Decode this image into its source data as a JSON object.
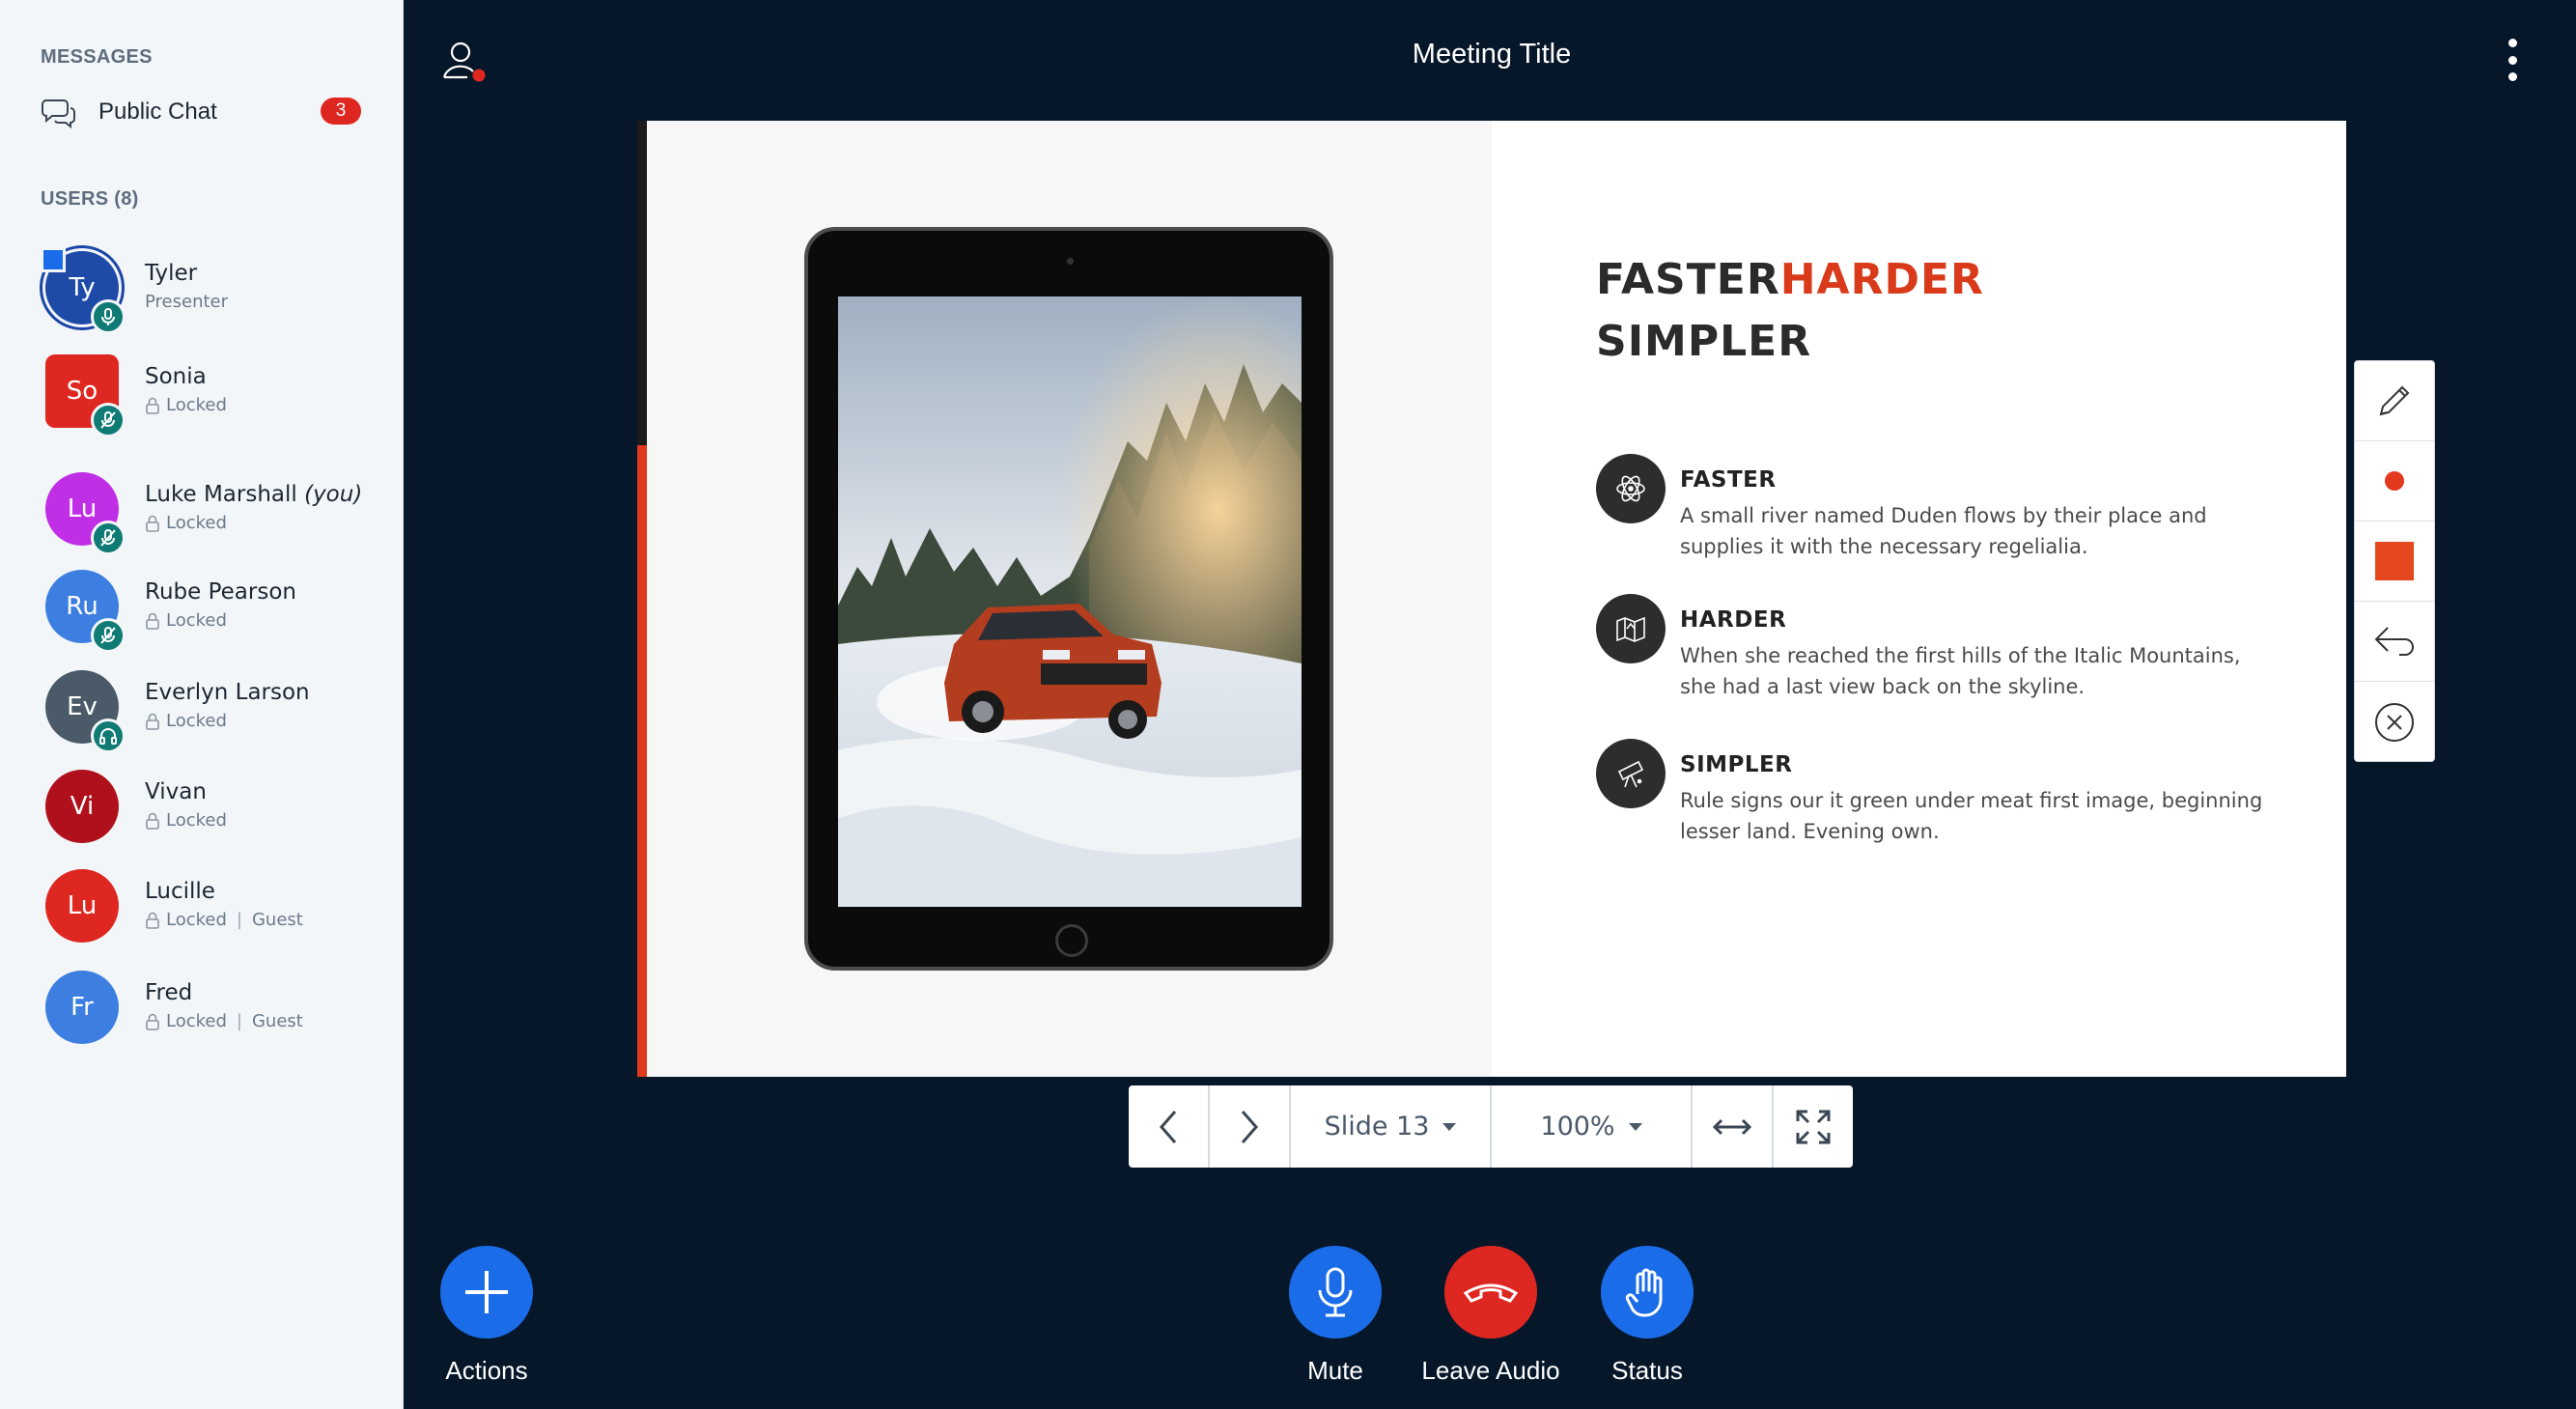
{
  "sidebar": {
    "messages_title": "MESSAGES",
    "public_chat": {
      "label": "Public Chat",
      "unread": "3",
      "icon": "chat-bubbles-icon"
    },
    "users_title": "USERS (8)",
    "users": [
      {
        "initials": "Ty",
        "name": "Tyler",
        "role": "Presenter",
        "color": "#1e4aa8",
        "status_icon": "microphone-icon"
      },
      {
        "initials": "So",
        "name": "Sonia",
        "status": "Locked",
        "color": "#df2721",
        "status_icon": "muted-icon"
      },
      {
        "initials": "Lu",
        "name": "Luke Marshall",
        "you": "(you)",
        "status": "Locked",
        "color": "#c02fe6",
        "status_icon": "muted-icon"
      },
      {
        "initials": "Ru",
        "name": "Rube Pearson",
        "status": "Locked",
        "color": "#3d7fe0",
        "status_icon": "muted-icon"
      },
      {
        "initials": "Ev",
        "name": "Everlyn Larson",
        "status": "Locked",
        "color": "#4a5a68",
        "status_icon": "headphones-icon"
      },
      {
        "initials": "Vi",
        "name": "Vivan",
        "status": "Locked",
        "color": "#b0101c"
      },
      {
        "initials": "Lu",
        "name": "Lucille",
        "status": "Locked",
        "tag": "Guest",
        "color": "#df2721"
      },
      {
        "initials": "Fr",
        "name": "Fred",
        "status": "Locked",
        "tag": "Guest",
        "color": "#3d7fe0"
      }
    ]
  },
  "header": {
    "title": "Meeting Title",
    "user_icon": "user-status-icon",
    "menu_icon": "kebab-menu-icon"
  },
  "slide": {
    "title_a": "FASTER",
    "title_b": "HARDER",
    "title_c": "SIMPLER",
    "features": [
      {
        "heading": "FASTER",
        "text": "A small river named Duden flows by their place and supplies it with the necessary regelialia.",
        "icon": "atom-icon"
      },
      {
        "heading": "HARDER",
        "text": "When she reached the first hills of the Italic Mountains, she had a last view back on the skyline.",
        "icon": "map-icon"
      },
      {
        "heading": "SIMPLER",
        "text": "Rule signs our it green under meat first image, beginning lesser land. Evening own.",
        "icon": "telescope-icon"
      }
    ]
  },
  "annotation_tools": [
    "pencil-icon",
    "color-dot-icon",
    "fill-square-icon",
    "undo-icon",
    "clear-icon"
  ],
  "presentation_controls": {
    "slide_label": "Slide 13",
    "zoom_label": "100%"
  },
  "actions": {
    "actions_label": "Actions",
    "mute_label": "Mute",
    "leave_audio_label": "Leave Audio",
    "status_label": "Status"
  },
  "colors": {
    "accent_blue": "#1b6ce8",
    "danger_red": "#df2721",
    "background": "#06172a",
    "slide_accent": "#d93a1a"
  }
}
